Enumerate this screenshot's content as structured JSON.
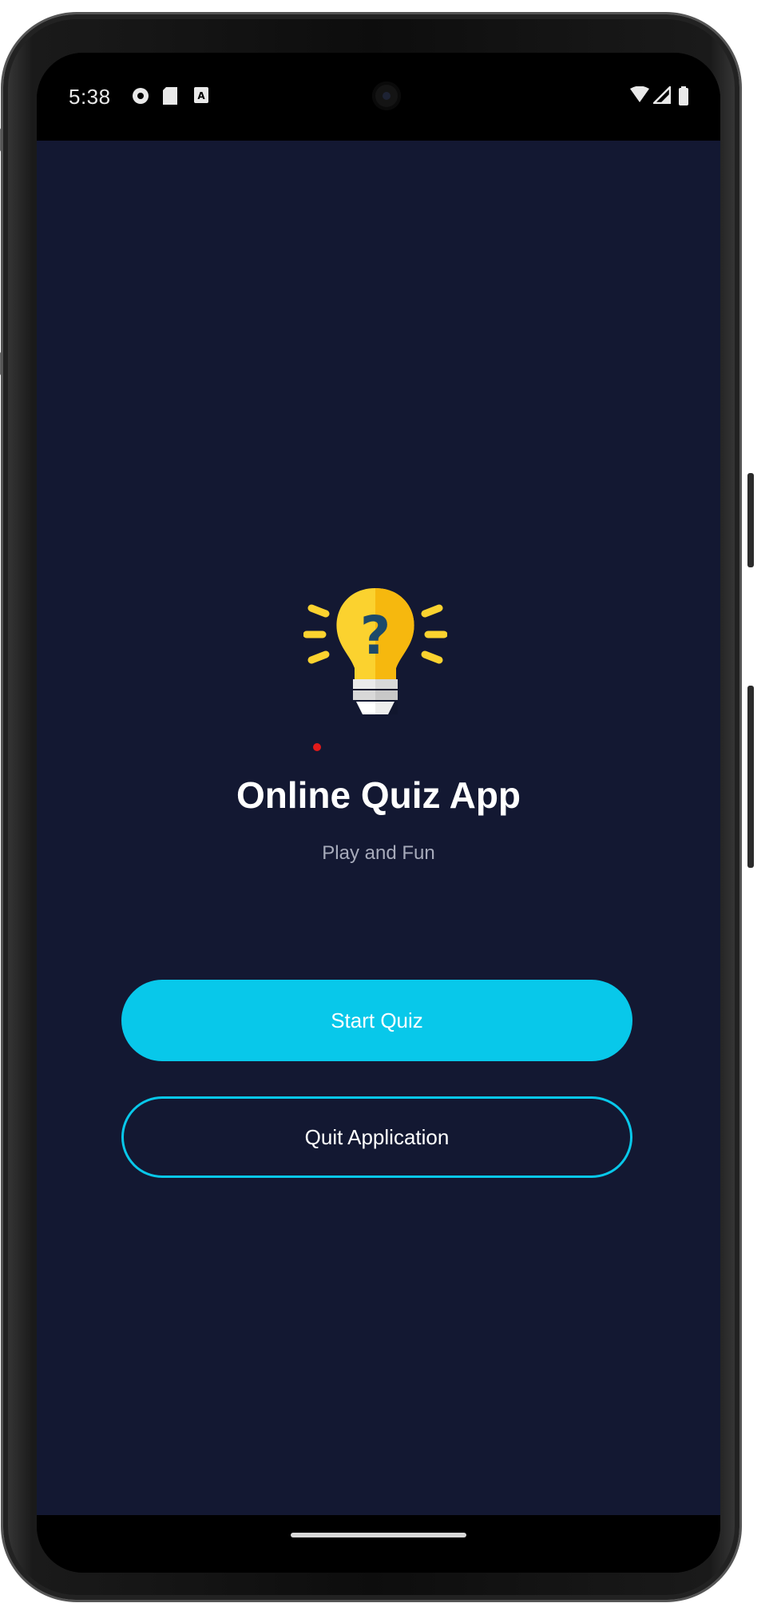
{
  "status_bar": {
    "time": "5:38",
    "left_icons": [
      "shield-icon",
      "sim-card-icon",
      "notification-a-icon"
    ],
    "right_icons": [
      "wifi-icon",
      "signal-icon",
      "battery-icon"
    ]
  },
  "app": {
    "logo_icon": "lightbulb-question-icon",
    "title": "Online Quiz App",
    "subtitle": "Play and Fun",
    "start_button_label": "Start Quiz",
    "quit_button_label": "Quit Application"
  },
  "colors": {
    "background": "#131832",
    "accent": "#08c8ea",
    "bulb": "#fbd22f",
    "question_mark": "#1d4a6a",
    "title": "#ffffff",
    "subtitle": "#a7abbb"
  }
}
